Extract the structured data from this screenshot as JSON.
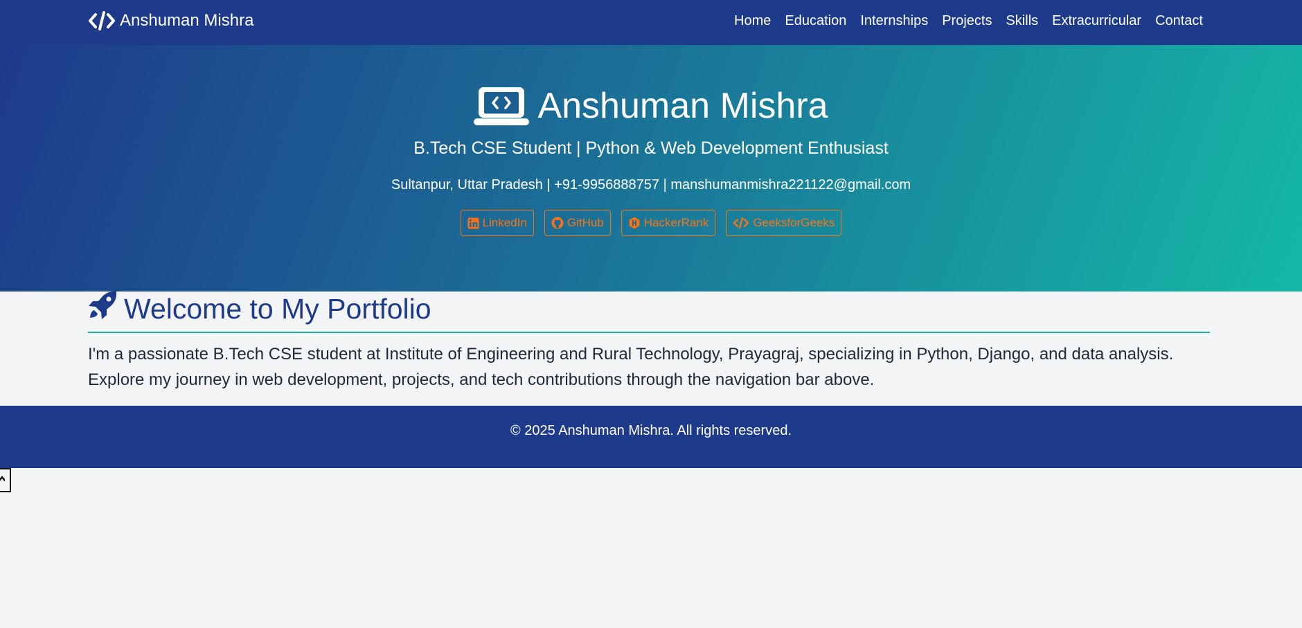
{
  "nav": {
    "brand": "Anshuman Mishra",
    "brand_icon": "code-icon",
    "links": [
      "Home",
      "Education",
      "Internships",
      "Projects",
      "Skills",
      "Extracurricular",
      "Contact"
    ]
  },
  "hero": {
    "title": "Anshuman Mishra",
    "title_icon": "laptop-code-icon",
    "subtitle": "B.Tech CSE Student | Python & Web Development Enthusiast",
    "contact": "Sultanpur, Uttar Pradesh | +91-9956888757 | manshumanmishra221122@gmail.com",
    "social": [
      {
        "label": "LinkedIn",
        "icon": "linkedin-icon"
      },
      {
        "label": "GitHub",
        "icon": "github-icon"
      },
      {
        "label": "HackerRank",
        "icon": "hackerrank-icon"
      },
      {
        "label": "GeeksforGeeks",
        "icon": "code-icon"
      }
    ]
  },
  "main": {
    "heading": "Welcome to My Portfolio",
    "heading_icon": "rocket-icon",
    "intro": "I'm a passionate B.Tech CSE student at Institute of Engineering and Rural Technology, Prayagraj, specializing in Python, Django, and data analysis. Explore my journey in web development, projects, and tech contributions through the navigation bar above."
  },
  "footer": {
    "copyright": "© 2025 Anshuman Mishra. All rights reserved."
  },
  "colors": {
    "primary": "#1e3a8a",
    "accent": "#14b8a6",
    "social": "#f97316",
    "background": "#f3f4f6"
  }
}
